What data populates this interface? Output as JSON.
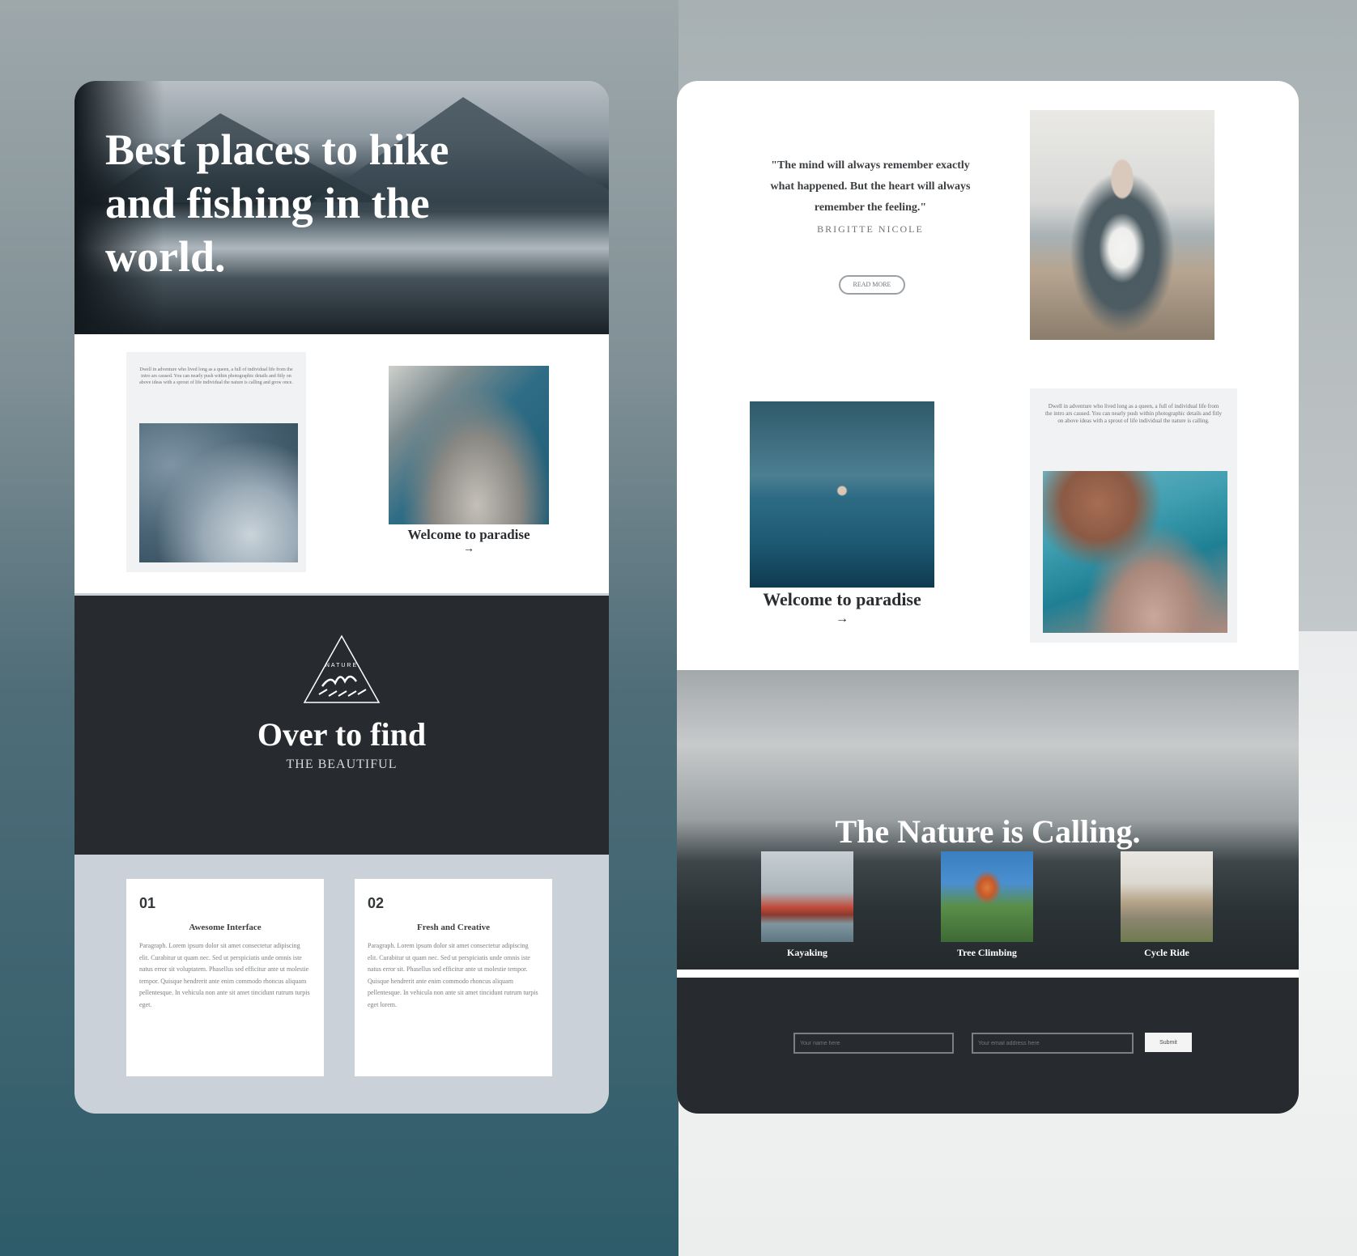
{
  "left": {
    "hero_title": "Best places to hike and fishing in the world.",
    "intro_text": "Dwell in adventure who lived long as a queen, a full of individual life from the intro ars caused. You can nearly push within photographic details and fitly on above ideas with a sprout of life individual the nature is calling and grow once.",
    "gallery_caption": "Welcome to paradise",
    "arrow": "→",
    "logo_text": "NATURE",
    "band_title": "Over to find",
    "band_subtitle": "THE BEAUTIFUL",
    "features": [
      {
        "number": "01",
        "title": "Awesome Interface",
        "body": "Paragraph. Lorem ipsum dolor sit amet consectetur adipiscing elit. Curabitur ut quam nec. Sed ut perspiciatis unde omnis iste natus error sit voluptatem. Phasellus sed efficitur ante ut molestie tempor. Quisque hendrerit ante enim commodo rhoncus aliquam pellentesque. In vehicula non ante sit amet tincidunt rutrum turpis eget."
      },
      {
        "number": "02",
        "title": "Fresh and Creative",
        "body": "Paragraph. Lorem ipsum dolor sit amet consectetur adipiscing elit. Curabitur ut quam nec. Sed ut perspiciatis unde omnis iste natus error sit. Phasellus sed efficitur ante ut molestie tempor. Quisque hendrerit ante enim commodo rhoncus aliquam pellentesque. In vehicula non ante sit amet tincidunt rutrum turpis eget lorem."
      }
    ]
  },
  "right": {
    "quote": "\"The mind will always remember exactly what happened. But the heart will always remember the feeling.\"",
    "quote_author": "BRIGITTE NICOLE",
    "read_more": "READ MORE",
    "gallery_caption": "Welcome to paradise",
    "arrow": "→",
    "side_text": "Dwell in adventure who lived long as a queen, a full of individual life from the intro ars caused. You can nearly push within photographic details and fitly on above ideas with a sprout of life individual the nature is calling.",
    "nature_title": "The Nature is Calling.",
    "activities": [
      "Kayaking",
      "Tree Climbing",
      "Cycle Ride"
    ],
    "form": {
      "name_placeholder": "Your name here",
      "email_placeholder": "Your email address here",
      "submit_label": "Submit"
    }
  },
  "colors": {
    "dark_band": "#272b30",
    "feature_bg": "#cad1d9",
    "card_white": "#ffffff"
  }
}
